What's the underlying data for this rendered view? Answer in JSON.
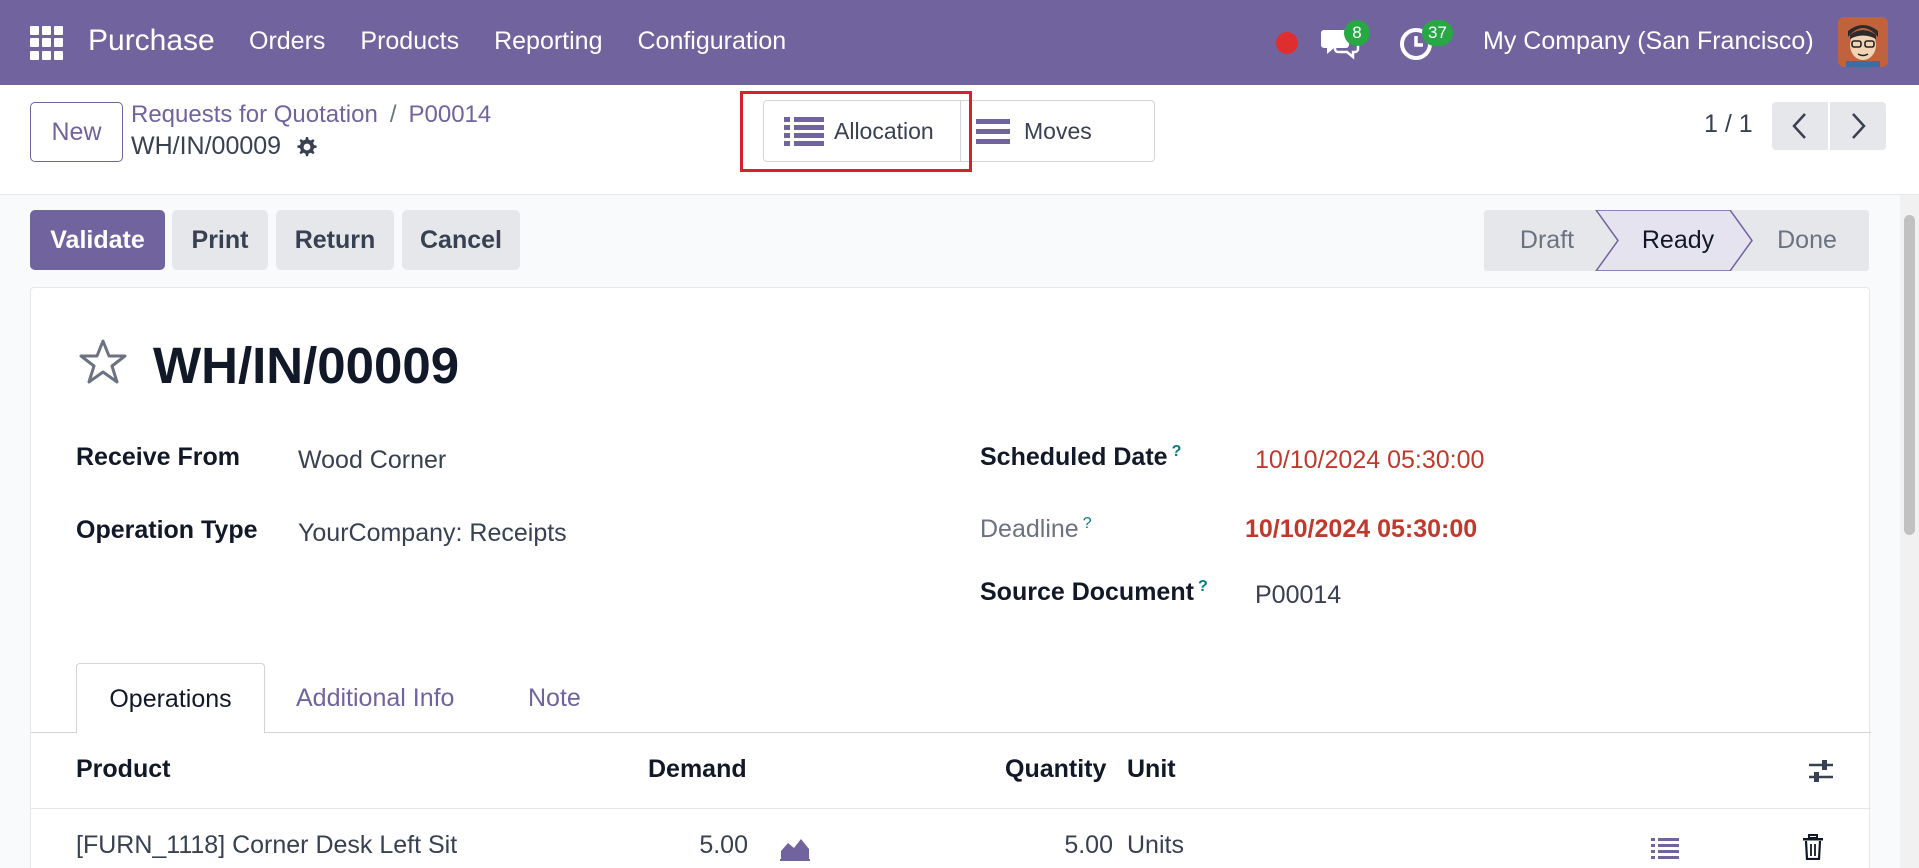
{
  "navbar": {
    "app_name": "Purchase",
    "menu": [
      "Orders",
      "Products",
      "Reporting",
      "Configuration"
    ],
    "chat_count": "8",
    "activity_count": "37",
    "company": "My Company (San Francisco)",
    "color": "#71639e"
  },
  "control_panel": {
    "new_label": "New",
    "breadcrumb": [
      "Requests for Quotation",
      "P00014"
    ],
    "record_name": "WH/IN/00009",
    "views": {
      "allocation": "Allocation",
      "moves": "Moves"
    },
    "pager": "1 / 1"
  },
  "actions": {
    "validate": "Validate",
    "print": "Print",
    "return": "Return",
    "cancel": "Cancel"
  },
  "statusbar": {
    "stages": [
      "Draft",
      "Ready",
      "Done"
    ],
    "current": "Ready"
  },
  "form": {
    "title": "WH/IN/00009",
    "receive_from_label": "Receive From",
    "receive_from": "Wood Corner",
    "operation_type_label": "Operation Type",
    "operation_type": "YourCompany: Receipts",
    "scheduled_date_label": "Scheduled Date",
    "scheduled_date": "10/10/2024 05:30:00",
    "deadline_label": "Deadline",
    "deadline": "10/10/2024 05:30:00",
    "source_document_label": "Source Document",
    "source_document": "P00014",
    "help_mark": "?"
  },
  "tabs": [
    "Operations",
    "Additional Info",
    "Note"
  ],
  "table": {
    "columns": [
      "Product",
      "Demand",
      "Quantity",
      "Unit"
    ],
    "rows": [
      {
        "product": "[FURN_1118] Corner Desk Left Sit",
        "demand": "5.00",
        "quantity": "5.00",
        "unit": "Units"
      }
    ]
  }
}
